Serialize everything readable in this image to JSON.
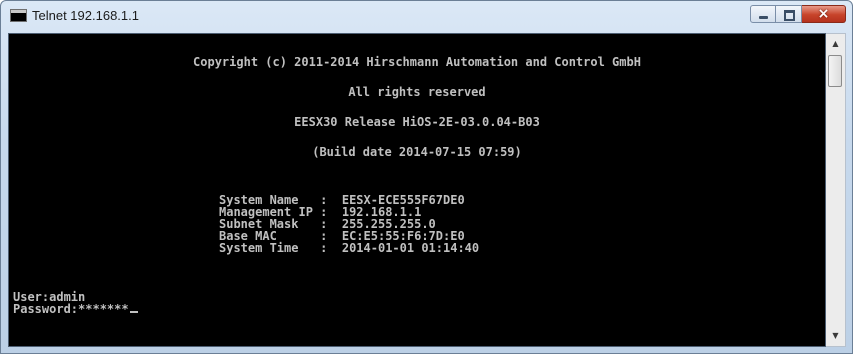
{
  "window": {
    "title": "Telnet 192.168.1.1",
    "icon": "console-icon",
    "buttons": {
      "minimize": "minimize-icon",
      "maximize": "maximize-icon",
      "close": "×"
    }
  },
  "console": {
    "banner": [
      "Copyright (c) 2011-2014 Hirschmann Automation and Control GmbH",
      "All rights reserved",
      "EESX30 Release HiOS-2E-03.0.04-B03",
      "(Build date 2014-07-15 07:59)"
    ],
    "system_info": [
      {
        "label": "System Name   ",
        "sep": ":",
        "value": "EESX-ECE555F67DE0"
      },
      {
        "label": "Management IP ",
        "sep": ":",
        "value": "192.168.1.1"
      },
      {
        "label": "Subnet Mask   ",
        "sep": ":",
        "value": "255.255.255.0"
      },
      {
        "label": "Base MAC      ",
        "sep": ":",
        "value": "EC:E5:55:F6:7D:E0"
      },
      {
        "label": "System Time   ",
        "sep": ":",
        "value": "2014-01-01 01:14:40"
      }
    ],
    "user_prompt": "User:admin",
    "password_prompt": "Password:*******"
  },
  "colors": {
    "console_bg": "#000000",
    "console_text": "#c0c0c0",
    "close_button": "#c7432a"
  }
}
